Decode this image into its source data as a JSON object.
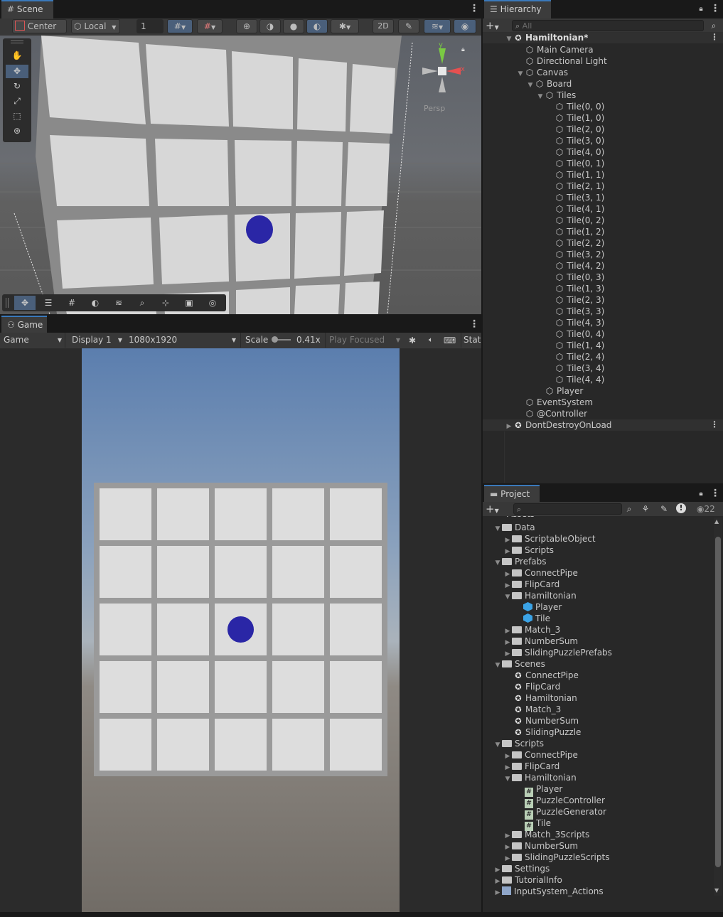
{
  "scene": {
    "tab_label": "Scene",
    "pivot_mode": "Center",
    "pivot_rotation": "Local",
    "grid_snap_value": "1",
    "overlay_2d": "2D",
    "persp_label": "Persp",
    "gizmo_y": "y",
    "gizmo_x": "x"
  },
  "game": {
    "tab_label": "Game",
    "view_mode": "Game",
    "display": "Display 1",
    "resolution": "1080x1920",
    "scale_label": "Scale",
    "scale_value": "0.41x",
    "play_mode": "Play Focused",
    "stats": "Stat"
  },
  "hierarchy": {
    "tab_label": "Hierarchy",
    "search_placeholder": "All",
    "scene_name": "Hamiltonian*",
    "items": [
      {
        "label": "Main Camera"
      },
      {
        "label": "Directional Light"
      },
      {
        "label": "Canvas"
      },
      {
        "label": "Board"
      },
      {
        "label": "Tiles"
      },
      {
        "label": "Tile(0, 0)"
      },
      {
        "label": "Tile(1, 0)"
      },
      {
        "label": "Tile(2, 0)"
      },
      {
        "label": "Tile(3, 0)"
      },
      {
        "label": "Tile(4, 0)"
      },
      {
        "label": "Tile(0, 1)"
      },
      {
        "label": "Tile(1, 1)"
      },
      {
        "label": "Tile(2, 1)"
      },
      {
        "label": "Tile(3, 1)"
      },
      {
        "label": "Tile(4, 1)"
      },
      {
        "label": "Tile(0, 2)"
      },
      {
        "label": "Tile(1, 2)"
      },
      {
        "label": "Tile(2, 2)"
      },
      {
        "label": "Tile(3, 2)"
      },
      {
        "label": "Tile(4, 2)"
      },
      {
        "label": "Tile(0, 3)"
      },
      {
        "label": "Tile(1, 3)"
      },
      {
        "label": "Tile(2, 3)"
      },
      {
        "label": "Tile(3, 3)"
      },
      {
        "label": "Tile(4, 3)"
      },
      {
        "label": "Tile(0, 4)"
      },
      {
        "label": "Tile(1, 4)"
      },
      {
        "label": "Tile(2, 4)"
      },
      {
        "label": "Tile(3, 4)"
      },
      {
        "label": "Tile(4, 4)"
      },
      {
        "label": "Player"
      },
      {
        "label": "EventSystem"
      },
      {
        "label": "@Controller"
      }
    ],
    "dont_destroy": "DontDestroyOnLoad"
  },
  "project": {
    "tab_label": "Project",
    "hidden_count": "22",
    "items": [
      {
        "label": "Data",
        "kind": "folder-open"
      },
      {
        "label": "ScriptableObject",
        "kind": "folder"
      },
      {
        "label": "Scripts",
        "kind": "folder"
      },
      {
        "label": "Prefabs",
        "kind": "folder-open"
      },
      {
        "label": "ConnectPipe",
        "kind": "folder"
      },
      {
        "label": "FlipCard",
        "kind": "folder"
      },
      {
        "label": "Hamiltonian",
        "kind": "folder-open"
      },
      {
        "label": "Player",
        "kind": "prefab"
      },
      {
        "label": "Tile",
        "kind": "prefab"
      },
      {
        "label": "Match_3",
        "kind": "folder"
      },
      {
        "label": "NumberSum",
        "kind": "folder"
      },
      {
        "label": "SlidingPuzzlePrefabs",
        "kind": "folder"
      },
      {
        "label": "Scenes",
        "kind": "folder-open"
      },
      {
        "label": "ConnectPipe",
        "kind": "scene"
      },
      {
        "label": "FlipCard",
        "kind": "scene"
      },
      {
        "label": "Hamiltonian",
        "kind": "scene"
      },
      {
        "label": "Match_3",
        "kind": "scene"
      },
      {
        "label": "NumberSum",
        "kind": "scene"
      },
      {
        "label": "SlidingPuzzle",
        "kind": "scene"
      },
      {
        "label": "Scripts",
        "kind": "folder-open"
      },
      {
        "label": "ConnectPipe",
        "kind": "folder"
      },
      {
        "label": "FlipCard",
        "kind": "folder"
      },
      {
        "label": "Hamiltonian",
        "kind": "folder-open"
      },
      {
        "label": "Player",
        "kind": "script"
      },
      {
        "label": "PuzzleController",
        "kind": "script"
      },
      {
        "label": "PuzzleGenerator",
        "kind": "script"
      },
      {
        "label": "Tile",
        "kind": "script"
      },
      {
        "label": "Match_3Scripts",
        "kind": "folder"
      },
      {
        "label": "NumberSum",
        "kind": "folder"
      },
      {
        "label": "SlidingPuzzleScripts",
        "kind": "folder"
      },
      {
        "label": "Settings",
        "kind": "folder"
      },
      {
        "label": "TutorialInfo",
        "kind": "folder"
      },
      {
        "label": "InputSystem_Actions",
        "kind": "asset"
      }
    ]
  },
  "colors": {
    "player": "#2a26a6",
    "tile": "#dddddd",
    "board": "#9a9a9a",
    "accent": "#3a79bb"
  }
}
